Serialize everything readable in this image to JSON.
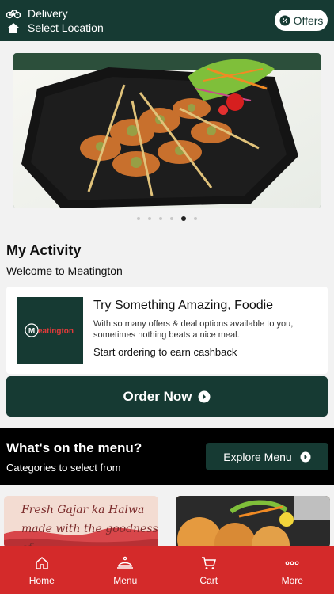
{
  "header": {
    "delivery_label": "Delivery",
    "location_label": "Select Location",
    "offers_label": "Offers"
  },
  "banner": {
    "slide_count": 6,
    "active_slide": 5
  },
  "activity": {
    "title": "My Activity",
    "subtitle": "Welcome to Meatington"
  },
  "promo_card": {
    "logo_text": "Meatington",
    "title": "Try Something Amazing, Foodie",
    "body": "With so many offers & deal options available to you, sometimes nothing beats a nice meal.",
    "cta": "Start ordering to earn cashback"
  },
  "order_button": {
    "label": "Order Now"
  },
  "menu_section": {
    "title": "What's on the menu?",
    "subtitle": "Categories to select from",
    "explore_label": "Explore Menu"
  },
  "categories": [
    {
      "text_line1": "Fresh Gajar ka Halwa",
      "text_line2": "made with the goodness of"
    },
    {}
  ],
  "bottom_nav": {
    "items": [
      {
        "label": "Home",
        "icon": "home-icon"
      },
      {
        "label": "Menu",
        "icon": "cloche-icon"
      },
      {
        "label": "Cart",
        "icon": "cart-icon"
      },
      {
        "label": "More",
        "icon": "more-icon"
      }
    ]
  },
  "colors": {
    "brand_green": "#163a33",
    "nav_red": "#d42a2a"
  }
}
